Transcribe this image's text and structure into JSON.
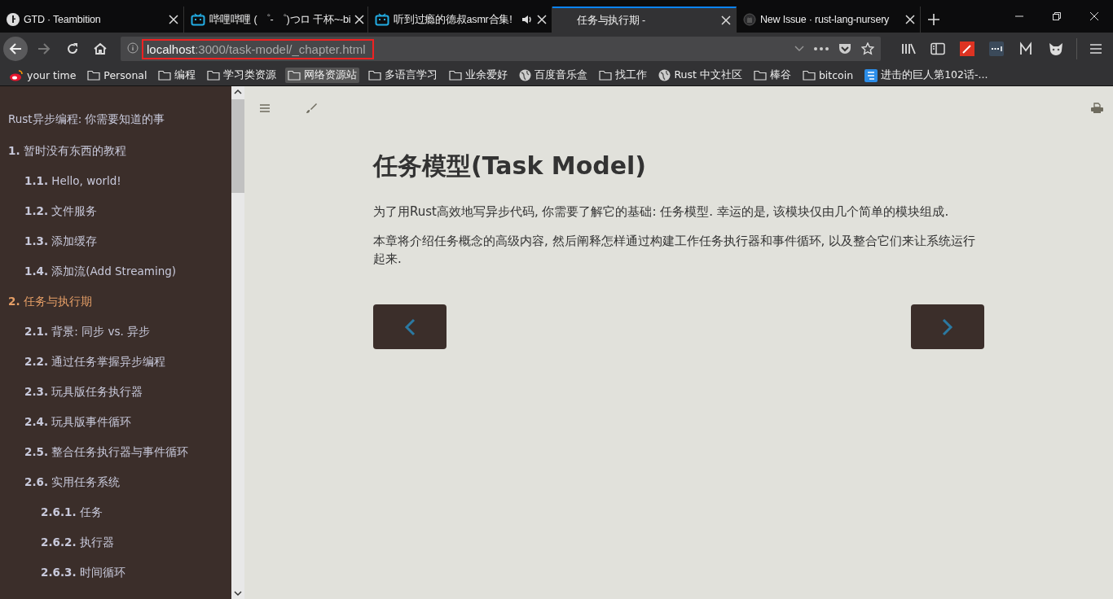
{
  "tabs": [
    {
      "title": "GTD · Teambition",
      "selected": false,
      "audio": false
    },
    {
      "title": "哔哩哔哩 ( ゜- ゜)つロ 干杯~-bi",
      "selected": false,
      "audio": false
    },
    {
      "title": "听到过瘾的德叔asmr合集!",
      "selected": false,
      "audio": true
    },
    {
      "title": "任务与执行期 -",
      "selected": true,
      "audio": false
    },
    {
      "title": "New Issue · rust-lang-nursery",
      "selected": false,
      "audio": false
    }
  ],
  "address": {
    "host": "localhost",
    "rest": ":3000/task-model/_chapter.html"
  },
  "bookmarks": [
    {
      "label": "your time",
      "kind": "site",
      "selected": false
    },
    {
      "label": "Personal",
      "kind": "folder",
      "selected": false
    },
    {
      "label": "编程",
      "kind": "folder",
      "selected": false
    },
    {
      "label": "学习类资源",
      "kind": "folder",
      "selected": false
    },
    {
      "label": "网络资源站",
      "kind": "folder",
      "selected": true
    },
    {
      "label": "多语言学习",
      "kind": "folder",
      "selected": false
    },
    {
      "label": "业余爱好",
      "kind": "folder",
      "selected": false
    },
    {
      "label": "百度音乐盒",
      "kind": "site",
      "selected": false
    },
    {
      "label": "找工作",
      "kind": "folder",
      "selected": false
    },
    {
      "label": "Rust 中文社区",
      "kind": "site",
      "selected": false
    },
    {
      "label": "棒谷",
      "kind": "folder",
      "selected": false
    },
    {
      "label": "bitcoin",
      "kind": "folder",
      "selected": false
    },
    {
      "label": "进击的巨人第102话-...",
      "kind": "site",
      "selected": false
    }
  ],
  "sidebar": {
    "title": "Rust异步编程: 你需要知道的事",
    "items": [
      {
        "number": "1.",
        "title": "暂时没有东西的教程",
        "selected": false,
        "children": [
          {
            "number": "1.1.",
            "title": "Hello, world!",
            "selected": false
          },
          {
            "number": "1.2.",
            "title": "文件服务",
            "selected": false
          },
          {
            "number": "1.3.",
            "title": "添加缓存",
            "selected": false
          },
          {
            "number": "1.4.",
            "title": "添加流(Add Streaming)",
            "selected": false
          }
        ]
      },
      {
        "number": "2.",
        "title": "任务与执行期",
        "selected": true,
        "children": [
          {
            "number": "2.1.",
            "title": "背景: 同步 vs. 异步",
            "selected": false
          },
          {
            "number": "2.2.",
            "title": "通过任务掌握异步编程",
            "selected": false
          },
          {
            "number": "2.3.",
            "title": "玩具版任务执行器",
            "selected": false
          },
          {
            "number": "2.4.",
            "title": "玩具版事件循环",
            "selected": false
          },
          {
            "number": "2.5.",
            "title": "整合任务执行器与事件循环",
            "selected": false
          },
          {
            "number": "2.6.",
            "title": "实用任务系统",
            "selected": false,
            "children": [
              {
                "number": "2.6.1.",
                "title": "任务",
                "selected": false
              },
              {
                "number": "2.6.2.",
                "title": "执行器",
                "selected": false
              },
              {
                "number": "2.6.3.",
                "title": "时间循环",
                "selected": false
              }
            ]
          }
        ]
      }
    ]
  },
  "content": {
    "heading": "任务模型(Task Model)",
    "paragraphs": [
      "为了用Rust高效地写异步代码, 你需要了解它的基础: 任务模型. 幸运的是, 该模块仅由几个简单的模块组成.",
      "本章将介绍任务概念的高级内容, 然后阐释怎样通过构建工作任务执行器和事件循环, 以及整合它们来让系统运行起来."
    ]
  }
}
